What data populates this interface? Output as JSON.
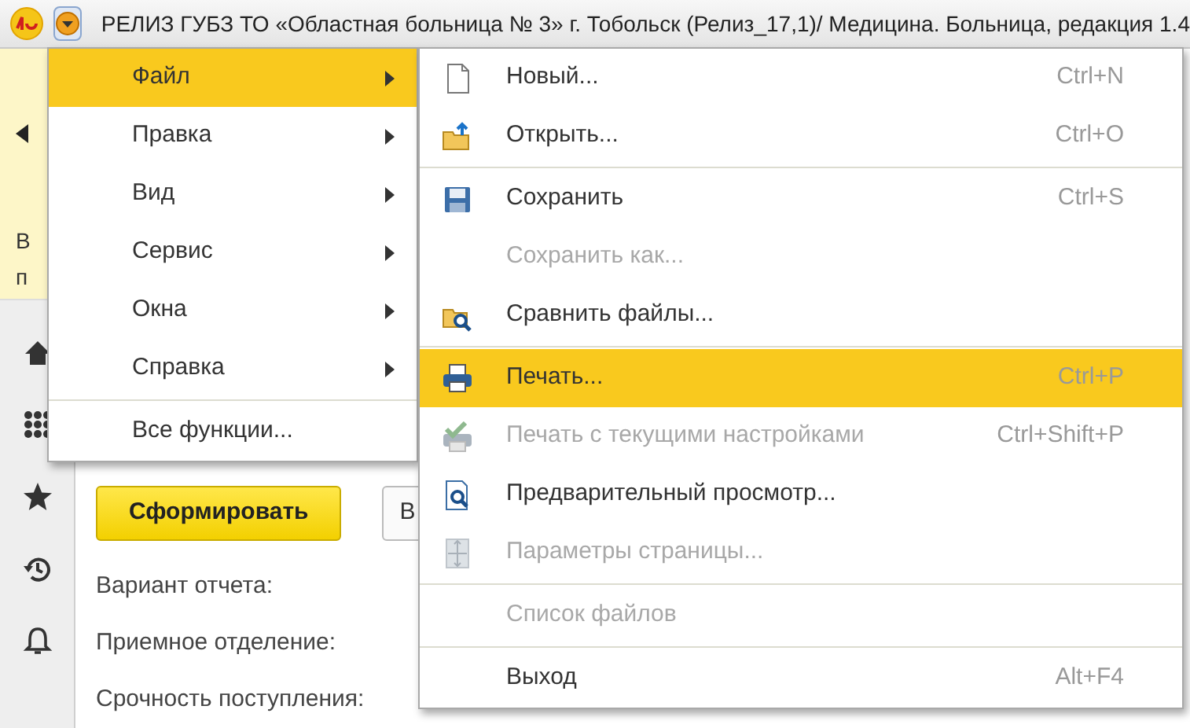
{
  "window": {
    "title": "РЕЛИЗ ГУБЗ ТО «Областная больница № 3» г. Тобольск (Релиз_17,1)/  Медицина. Больница, редакция 1.4",
    "menu_button_pressed": true
  },
  "info_panel": {
    "text_fragments": [
      "В",
      "п"
    ]
  },
  "sidebar": {
    "items": [
      {
        "kind": "home"
      },
      {
        "kind": "apps"
      },
      {
        "kind": "star"
      },
      {
        "kind": "history"
      },
      {
        "kind": "bell"
      }
    ]
  },
  "form": {
    "buttons": [
      {
        "label": "Сформировать",
        "kind": "primary"
      },
      {
        "label": "В",
        "kind": "default"
      }
    ],
    "fields": [
      {
        "label": "Вариант отчета:"
      },
      {
        "label": "Приемное отделение:"
      },
      {
        "label": "Срочность поступления:"
      }
    ]
  },
  "main_menu": {
    "items": [
      {
        "kind": "item",
        "label": "Файл",
        "submenu": true,
        "selected": true
      },
      {
        "kind": "item",
        "label": "Правка",
        "submenu": true,
        "selected": false
      },
      {
        "kind": "item",
        "label": "Вид",
        "submenu": true,
        "selected": false
      },
      {
        "kind": "item",
        "label": "Сервис",
        "submenu": true,
        "selected": false
      },
      {
        "kind": "item",
        "label": "Окна",
        "submenu": true,
        "selected": false
      },
      {
        "kind": "item",
        "label": "Справка",
        "submenu": true,
        "selected": false
      },
      {
        "kind": "separator"
      },
      {
        "kind": "item",
        "label": "Все функции...",
        "submenu": false,
        "selected": false
      }
    ]
  },
  "file_menu": {
    "items": [
      {
        "kind": "new",
        "label": "Новый...",
        "shortcut": "Ctrl+N",
        "disabled": false,
        "selected": false
      },
      {
        "kind": "open",
        "label": "Открыть...",
        "shortcut": "Ctrl+O",
        "disabled": false,
        "selected": false
      },
      {
        "kind": "separator"
      },
      {
        "kind": "save",
        "label": "Сохранить",
        "shortcut": "Ctrl+S",
        "disabled": false,
        "selected": false
      },
      {
        "kind": "item",
        "label": "Сохранить как...",
        "disabled": true,
        "selected": false
      },
      {
        "kind": "compare",
        "label": "Сравнить файлы...",
        "disabled": false,
        "selected": false
      },
      {
        "kind": "separator"
      },
      {
        "kind": "print",
        "label": "Печать...",
        "shortcut": "Ctrl+P",
        "disabled": false,
        "selected": true
      },
      {
        "kind": "print-check",
        "label": "Печать с текущими настройками",
        "shortcut": "Ctrl+Shift+P",
        "disabled": true,
        "selected": false
      },
      {
        "kind": "preview",
        "label": "Предварительный просмотр...",
        "disabled": false,
        "selected": false
      },
      {
        "kind": "page",
        "label": "Параметры страницы...",
        "disabled": true,
        "selected": false
      },
      {
        "kind": "separator"
      },
      {
        "kind": "item",
        "label": "Список файлов",
        "disabled": true,
        "selected": false
      },
      {
        "kind": "separator"
      },
      {
        "kind": "item",
        "label": "Выход",
        "shortcut": "Alt+F4",
        "disabled": false,
        "selected": false
      }
    ]
  }
}
